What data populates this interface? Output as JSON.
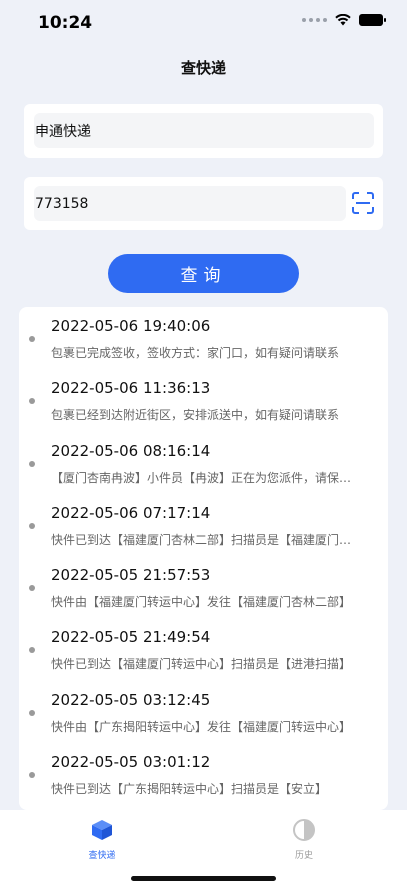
{
  "status_bar": {
    "time": "10:24"
  },
  "header": {
    "title": "查快递"
  },
  "form": {
    "company_value": "申通快递",
    "tracking_value": "773158",
    "query_label": "查询"
  },
  "results": [
    {
      "time": "2022-05-06 19:40:06",
      "desc": "包裹已完成签收，签收方式：家门口，如有疑问请联系"
    },
    {
      "time": "2022-05-06 11:36:13",
      "desc": "包裹已经到达附近街区，安排派送中，如有疑问请联系"
    },
    {
      "time": "2022-05-06 08:16:14",
      "desc": "【厦门杏南冉波】小件员【冉波】正在为您派件，请保持电话畅通"
    },
    {
      "time": "2022-05-06 07:17:14",
      "desc": "快件已到达【福建厦门杏林二部】扫描员是【福建厦门杏林二部】"
    },
    {
      "time": "2022-05-05 21:57:53",
      "desc": "快件由【福建厦门转运中心】发往【福建厦门杏林二部】"
    },
    {
      "time": "2022-05-05 21:49:54",
      "desc": "快件已到达【福建厦门转运中心】扫描员是【进港扫描】"
    },
    {
      "time": "2022-05-05 03:12:45",
      "desc": "快件由【广东揭阳转运中心】发往【福建厦门转运中心】"
    },
    {
      "time": "2022-05-05 03:01:12",
      "desc": "快件已到达【广东揭阳转运中心】扫描员是【安立】"
    }
  ],
  "tabbar": {
    "home_label": "查快递",
    "history_label": "历史"
  },
  "icons": {
    "scan": "scan-icon",
    "home": "box-icon",
    "history": "history-icon"
  },
  "colors": {
    "accent": "#2F6BF2",
    "background": "#EEF1F8"
  }
}
